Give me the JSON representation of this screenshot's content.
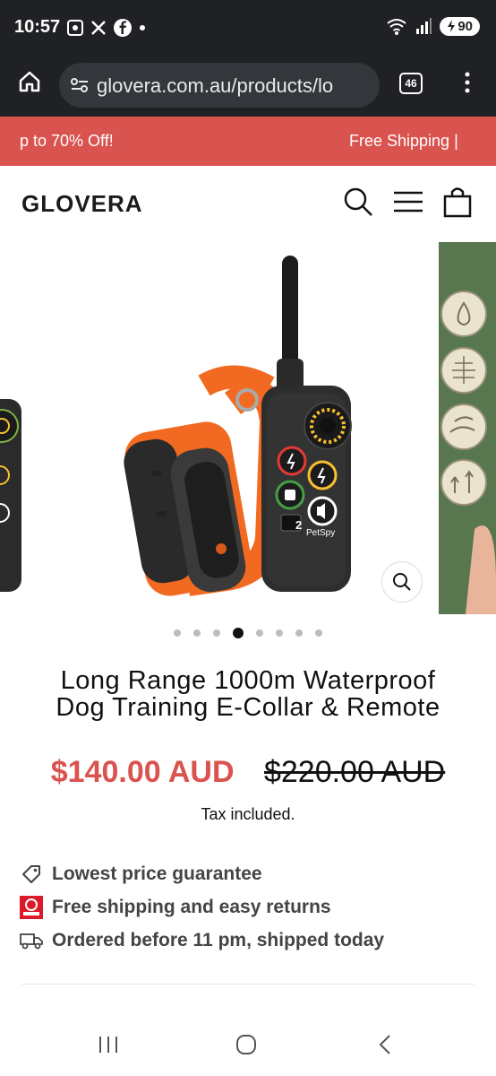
{
  "status_bar": {
    "time": "10:57",
    "battery": "90",
    "left_icons": [
      "screenshot-icon",
      "x-icon",
      "facebook-icon",
      "dot-icon"
    ],
    "right_icons": [
      "wifi-icon",
      "signal-icon",
      "battery-icon"
    ]
  },
  "browser": {
    "url": "glovera.com.au/products/lo",
    "tabs_count": "46"
  },
  "banner": {
    "left_text": "p to 70% Off!",
    "right_text": "Free Shipping | "
  },
  "header": {
    "logo": "GLOVERA"
  },
  "gallery": {
    "device_label": "PetSpy",
    "remote_button_2": "2",
    "dot_count": 8,
    "active_index": 3
  },
  "product": {
    "title_line1": "Long Range 1000m Waterproof",
    "title_line2": "Dog Training E-Collar & Remote",
    "sale_price": "$140.00 AUD",
    "regular_price": "$220.00 AUD",
    "tax_note": "Tax included."
  },
  "features": [
    {
      "icon": "tag-icon",
      "label": "Lowest price guarantee"
    },
    {
      "icon": "auspost-icon",
      "label": "Free shipping and easy returns"
    },
    {
      "icon": "truck-icon",
      "label": "Ordered before 11 pm, shipped today"
    }
  ],
  "colors": {
    "accent": "#d9534f",
    "collar_orange": "#f26a21",
    "dark_chrome": "#202124"
  }
}
